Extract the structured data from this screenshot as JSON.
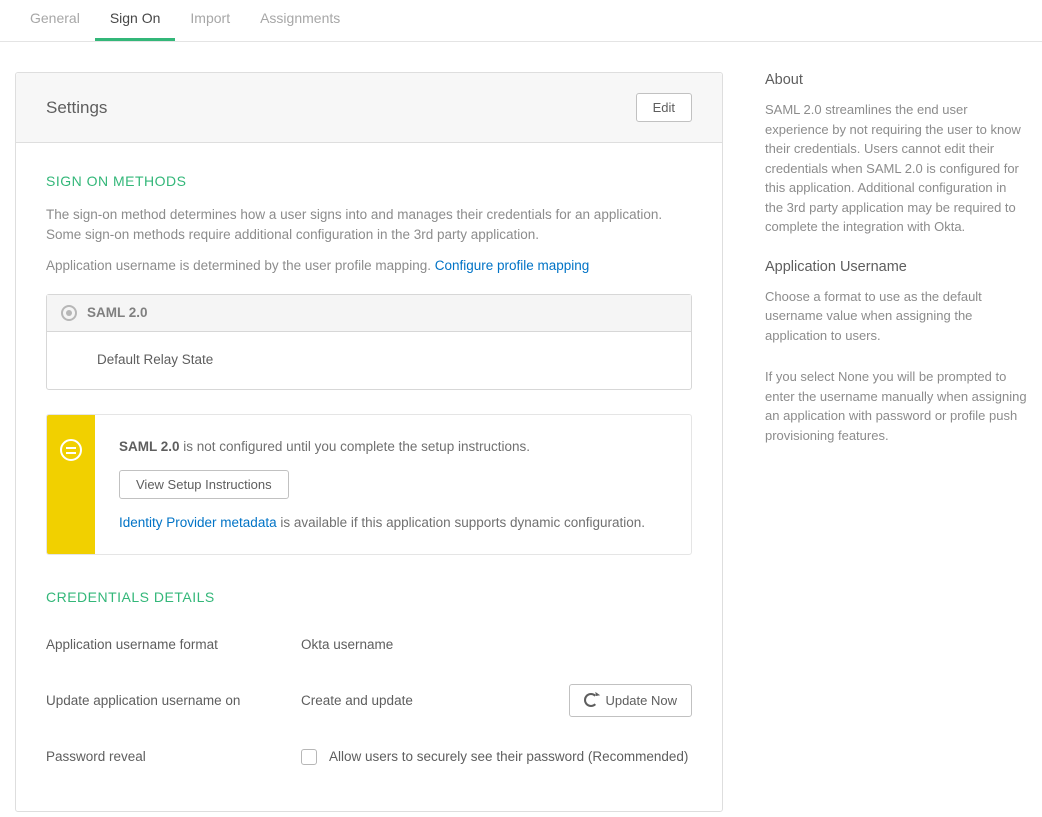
{
  "tabs": {
    "general": "General",
    "signon": "Sign On",
    "import": "Import",
    "assignments": "Assignments"
  },
  "panel": {
    "title": "Settings",
    "edit": "Edit"
  },
  "signon_methods": {
    "heading": "SIGN ON METHODS",
    "desc1": "The sign-on method determines how a user signs into and manages their credentials for an application. Some sign-on methods require additional configuration in the 3rd party application.",
    "desc2_prefix": "Application username is determined by the user profile mapping. ",
    "desc2_link": "Configure profile mapping",
    "method_label": "SAML 2.0",
    "default_relay": "Default Relay State"
  },
  "alert": {
    "strong": "SAML 2.0",
    "text_after": " is not configured until you complete the setup instructions.",
    "view_btn": "View Setup Instructions",
    "idp_link": "Identity Provider metadata",
    "idp_after": " is available if this application supports dynamic configuration."
  },
  "credentials": {
    "heading": "CREDENTIALS DETAILS",
    "app_user_fmt_label": "Application username format",
    "app_user_fmt_value": "Okta username",
    "update_on_label": "Update application username on",
    "update_on_value": "Create and update",
    "update_now": "Update Now",
    "pwd_reveal_label": "Password reveal",
    "pwd_reveal_text": "Allow users to securely see their password (Recommended)"
  },
  "side": {
    "about_h": "About",
    "about_p": "SAML 2.0 streamlines the end user experience by not requiring the user to know their credentials. Users cannot edit their credentials when SAML 2.0 is configured for this application. Additional configuration in the 3rd party application may be required to complete the integration with Okta.",
    "appuser_h": "Application Username",
    "appuser_p1": "Choose a format to use as the default username value when assigning the application to users.",
    "appuser_p2": "If you select None you will be prompted to enter the username manually when assigning an application with password or profile push provisioning features."
  }
}
